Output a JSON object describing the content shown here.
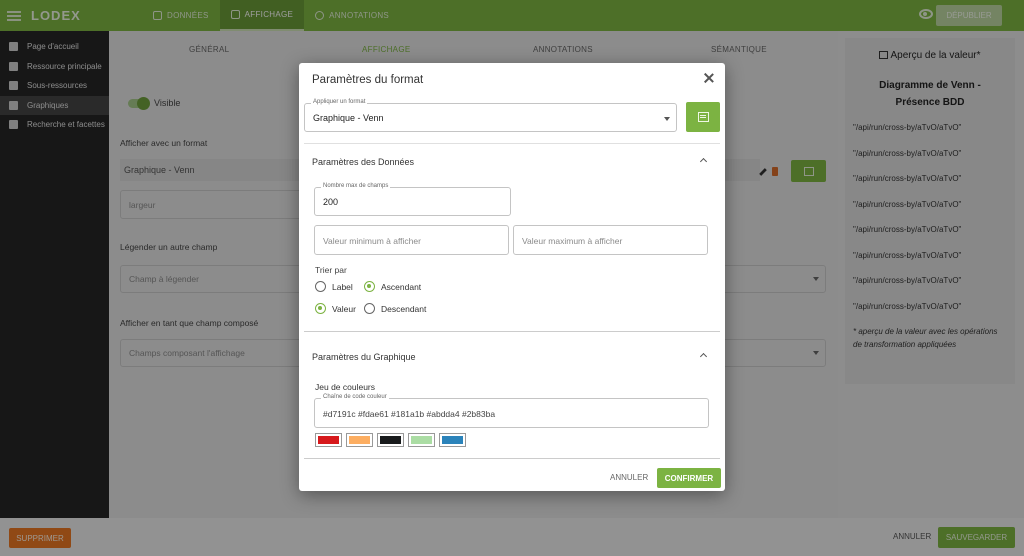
{
  "app": {
    "logo": "LODEX"
  },
  "topnav": {
    "donnees": "DONNÉES",
    "affichage": "AFFICHAGE",
    "annotations": "ANNOTATIONS",
    "publish": "DÉPUBLIER"
  },
  "sidebar": {
    "items": [
      {
        "label": "Page d'accueil"
      },
      {
        "label": "Ressource principale"
      },
      {
        "label": "Sous-ressources"
      },
      {
        "label": "Graphiques"
      },
      {
        "label": "Recherche et facettes"
      }
    ]
  },
  "subtabs": {
    "general": "GÉNÉRAL",
    "affichage": "AFFICHAGE",
    "annotations": "ANNOTATIONS",
    "semantique": "SÉMANTIQUE"
  },
  "form": {
    "visible": "Visible",
    "format_label": "Afficher avec un format",
    "format_value": "Graphique - Venn",
    "width_placeholder": "largeur",
    "legend_label": "Légender un autre champ",
    "legend_placeholder": "Champ à légender",
    "composed_label": "Afficher en tant que champ composé",
    "composed_placeholder": "Champs composant l'affichage"
  },
  "preview": {
    "title": "Aperçu de la valeur*",
    "heading": "Diagramme de Venn - Présence BDD",
    "lines": [
      "\"/api/run/cross-by/aTvO/aTvO\"",
      "\"/api/run/cross-by/aTvO/aTvO\"",
      "\"/api/run/cross-by/aTvO/aTvO\"",
      "\"/api/run/cross-by/aTvO/aTvO\"",
      "\"/api/run/cross-by/aTvO/aTvO\"",
      "\"/api/run/cross-by/aTvO/aTvO\"",
      "\"/api/run/cross-by/aTvO/aTvO\"",
      "\"/api/run/cross-by/aTvO/aTvO\""
    ],
    "note": "* aperçu de la valeur avec les opérations de transformation appliquées"
  },
  "footer": {
    "delete": "SUPPRIMER",
    "cancel": "ANNULER",
    "save": "SAUVEGARDER"
  },
  "dialog": {
    "title": "Paramètres du format",
    "apply_label": "Appliquer un format",
    "apply_value": "Graphique - Venn",
    "data_section": "Paramètres des Données",
    "max_fields_label": "Nombre max de champs",
    "max_fields_value": "200",
    "min_placeholder": "Valeur minimum à afficher",
    "max_placeholder": "Valeur maximum à afficher",
    "sort_label": "Trier par",
    "sort_label_option": "Label",
    "sort_value_option": "Valeur",
    "order_asc": "Ascendant",
    "order_desc": "Descendant",
    "chart_section": "Paramètres du Graphique",
    "colorset_label": "Jeu de couleurs",
    "color_string_label": "Chaîne de code couleur",
    "color_string_value": "#d7191c #fdae61 #181a1b #abdda4 #2b83ba",
    "colors": [
      "#d7191c",
      "#fdae61",
      "#181a1b",
      "#abdda4",
      "#2b83ba"
    ],
    "cancel": "ANNULER",
    "confirm": "CONFIRMER"
  }
}
